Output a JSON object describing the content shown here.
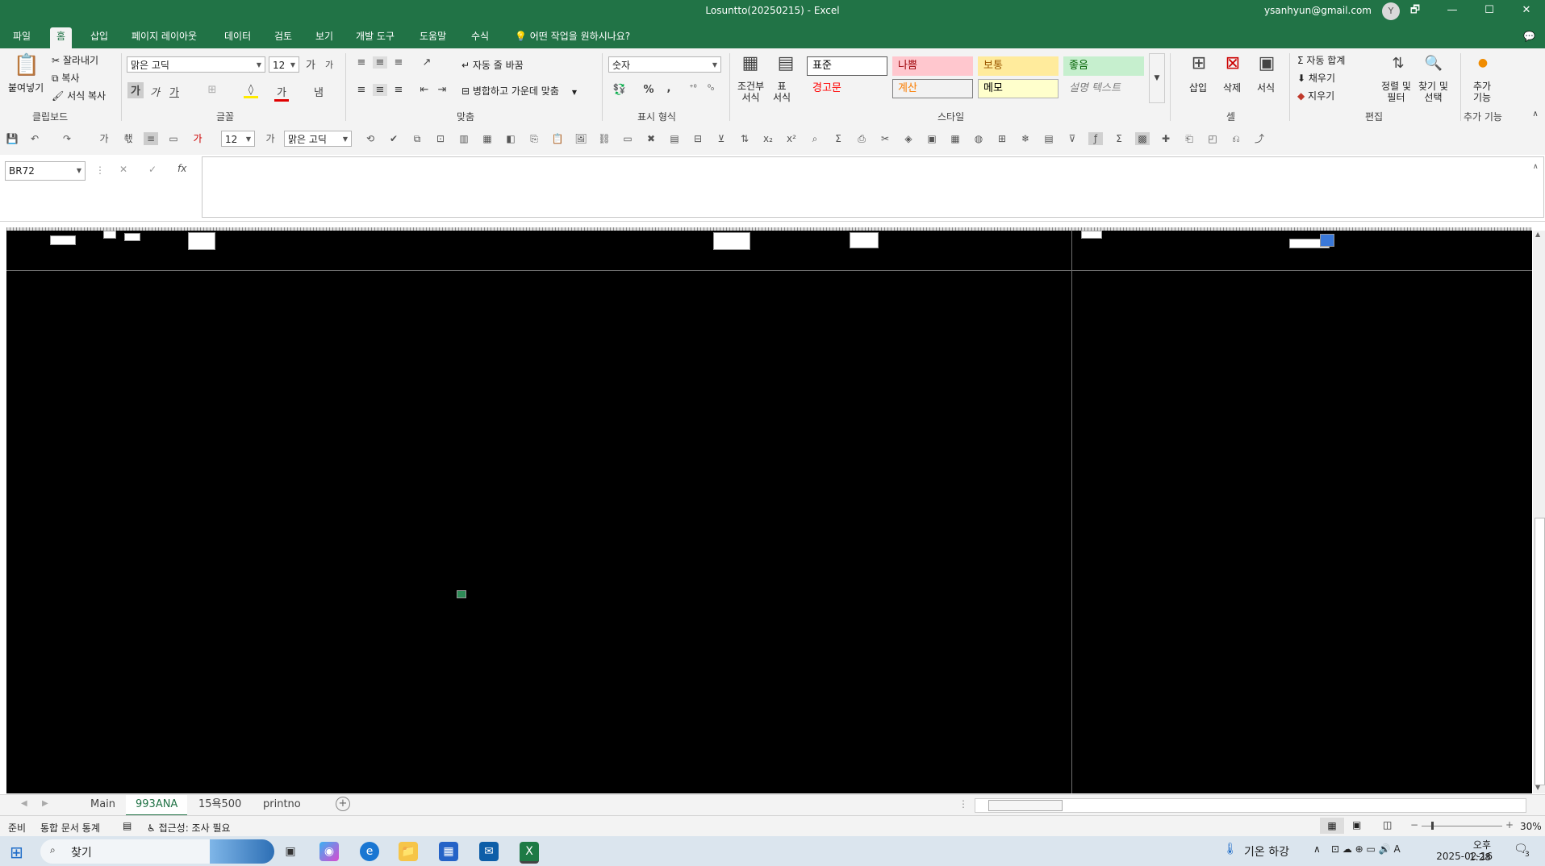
{
  "window": {
    "title": "Losuntto(20250215)  -  Excel",
    "account": "ysanhyun@gmail.com",
    "avatar_letter": "Y",
    "controls": [
      "🗗",
      "—",
      "☐",
      "✕"
    ]
  },
  "menu": {
    "tabs": [
      "파일",
      "홈",
      "삽입",
      "페이지 레이아웃",
      "데이터",
      "검토",
      "보기",
      "개발 도구",
      "도움말",
      "수식"
    ],
    "active_tab": "홈",
    "tell_me": "어떤 작업을 원하시나요?"
  },
  "ribbon": {
    "clipboard": {
      "paste": "붙여넣기",
      "cut": "잘라내기",
      "copy": "복사",
      "format_painter": "서식 복사",
      "label": "클립보드"
    },
    "font": {
      "font_name": "맑은 고딕",
      "font_size": "12",
      "grow": "가",
      "shrink": "가",
      "bold": "가",
      "italic": "가",
      "underline": "가",
      "border": "⊞",
      "fill": "◊",
      "color": "가",
      "phonetic": "냄",
      "label": "글꼴"
    },
    "alignment": {
      "wrap_text": "자동 줄 바꿈",
      "merge_center": "병합하고 가운데 맞춤",
      "label": "맞춤"
    },
    "number": {
      "format": "숫자",
      "percent": "%",
      "comma": ",",
      "label": "표시 형식"
    },
    "styles": {
      "conditional": "조건부\n서식",
      "format_table": "표\n서식",
      "cells": [
        {
          "label": "표준",
          "bg": "#ffffff",
          "fg": "#000000",
          "border": "#5b5b5b"
        },
        {
          "label": "나쁨",
          "bg": "#ffc7ce",
          "fg": "#9c0006",
          "border": "#ffc7ce"
        },
        {
          "label": "보통",
          "bg": "#ffeb9c",
          "fg": "#9c5700",
          "border": "#ffeb9c"
        },
        {
          "label": "좋음",
          "bg": "#c6efce",
          "fg": "#006100",
          "border": "#c6efce"
        },
        {
          "label": "경고문",
          "bg": "#f3f3f3",
          "fg": "#ff0000",
          "border": "#f3f3f3"
        },
        {
          "label": "계산",
          "bg": "#f2f2f2",
          "fg": "#fa7d00",
          "border": "#7f7f7f"
        },
        {
          "label": "메모",
          "bg": "#ffffcc",
          "fg": "#000000",
          "border": "#b2b2b2"
        },
        {
          "label": "설명 텍스트",
          "bg": "#f3f3f3",
          "fg": "#7f7f7f",
          "border": "#f3f3f3"
        }
      ],
      "label": "스타일"
    },
    "cells": {
      "insert": "삽입",
      "delete": "삭제",
      "format": "서식",
      "label": "셀"
    },
    "editing": {
      "autosum": "자동 합계",
      "fill": "채우기",
      "clear": "지우기",
      "sort_filter": "정렬 및\n필터",
      "find_select": "찾기 및\n선택",
      "label": "편집"
    },
    "addins": {
      "addins": "추가\n기능",
      "label": "추가 기능"
    }
  },
  "qat": {
    "font_size": "12",
    "font_name": "맑은 고딕"
  },
  "formula_bar": {
    "name_box": "BR72",
    "fx": "fx",
    "content": ""
  },
  "sheet_tabs": {
    "tabs": [
      "Main",
      "993ANA",
      "15욕500",
      "printno"
    ],
    "active": "993ANA"
  },
  "status": {
    "ready": "준비",
    "stats": "통합 문서 통계",
    "accessibility": "접근성: 조사 필요",
    "zoom": "30%"
  },
  "taskbar": {
    "search": "찾기",
    "weather": "기온 하강",
    "time": "오후 1:28",
    "date": "2025-02-16",
    "notification_count": "3"
  },
  "colors": {
    "excel_green": "#217346",
    "ribbon_bg": "#f3f3f3"
  }
}
